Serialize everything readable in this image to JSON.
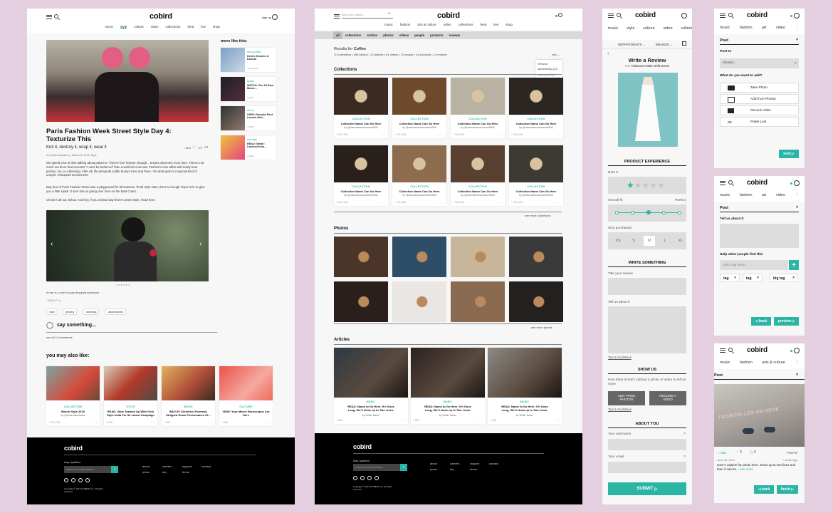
{
  "brand": "cobird",
  "colors": {
    "accent": "#2bb5a5",
    "background": "#e3cfe0",
    "footer": "#000000"
  },
  "article_page": {
    "header": {
      "signup": "sign up",
      "nav": [
        "music",
        "style",
        "culture",
        "video",
        "collections",
        "feed",
        "live",
        "shop"
      ],
      "active": "style"
    },
    "title": "Paris Fashion Week Street Style Day 4: Texturize This",
    "subtitle": "Knit it, destroy it, wrap it, wear it",
    "byline": "by Hayden Macaleno | March 04, 2018 | Style",
    "add_label": "+ ADD",
    "like_count": "270",
    "para1": "We spend a lot of time talking about patterns—they're fun! Texture, though... texture deserves more love. There's not much out there that screams \"I can't be bothered\" than a well-knit overcoat. Fashion's love affair with teddy bear jackets, too, is a blessing. After all, life demands a little texture here and there. It's what gives it a special kind of oomph. Chutzpah! Excitement!",
    "para2": "Day four of Paris Fashion Week was a playground for all textures. Timid style stars, there's enough inspo here to give you a little spark. It sure has us going over here on the East Coast.",
    "para3": "Check it all out, below. And hey, if you missed day three's street style, head here.",
    "caption": "A rose is a rose is a jaw-dropping accessory.",
    "tags": [
      "rose",
      "jewelry",
      "earrings",
      "accessories"
    ],
    "say_something": "say something...",
    "see_comments": "see all 15 comments",
    "more_like_this": "more like this:",
    "sidebar": [
      {
        "category": "COLLECTION",
        "title": "Denim Dreams & Donuts",
        "meta": "+ FOLLOW"
      },
      {
        "category": "MUSIC",
        "title": "WATCH: The 15 Best Music...",
        "meta": "+ ADD"
      },
      {
        "category": "STYLE",
        "title": "VIEW: Favorite Post Launch Nail...",
        "meta": "+ ADD"
      },
      {
        "category": "CULTURE",
        "title": "READ: What I Learned from...",
        "meta": "+ ADD"
      }
    ],
    "you_may_like": "you may also like:",
    "related": [
      {
        "category": "COLLECTION",
        "title": "Beach Style 2018",
        "sub": "by @bohemianchicna",
        "meta": "+ FOLLOW"
      },
      {
        "category": "STYLE",
        "title": "READ: Vans Teamed Up With Girls Style India For Its Latest Campaign",
        "sub": "",
        "meta": "+ ADD"
      },
      {
        "category": "MUSIC",
        "title": "WATCH: Kiersha's Powerful, Stripped Down Performance Of...",
        "sub": "",
        "meta": "+ ADD"
      },
      {
        "category": "CULTURE",
        "title": "VIEW: Your March Horoscopes Are Here",
        "sub": "",
        "meta": "+ ADD"
      }
    ]
  },
  "search_page": {
    "search_placeholder": "type your search ...",
    "nav": [
      "music",
      "fashion",
      "arts & culture",
      "video",
      "collections",
      "feed",
      "live",
      "shop"
    ],
    "filters": [
      "all",
      "collections",
      "articles",
      "photos",
      "videos",
      "people",
      "products",
      "reviews"
    ],
    "results_label": "Results for",
    "query": "Coffee",
    "counts": "10 collections • 465 photos • 22 articles • 81 videos • 31 people • 14 products • 12 reviews",
    "sort": "sort",
    "sort_options": [
      "relevance",
      "alphabetically (A-Z)",
      "most recent first",
      "oldest first"
    ],
    "collections_heading": "Collections",
    "collection_card": {
      "category": "COLLECTION",
      "title": "Collection Name Can Go Here",
      "sub": "by @usernameusername9906",
      "meta": "+ FOLLOW"
    },
    "see_more_collections": "see more collections",
    "photos_heading": "Photos",
    "see_more_photos": "see more photos",
    "articles_heading": "Articles",
    "article_card": {
      "category": "MUSIC",
      "title": "READ: Name to Go Here. If It Goes Long, We'll show up to Two Lines.",
      "sub": "by Writer Name",
      "meta": "+ ADD"
    }
  },
  "footer": {
    "stay_updated": "stay updated",
    "email_placeholder": "enter your email address",
    "links": [
      "about",
      "careers",
      "support",
      "contact",
      "press",
      "faq",
      "terms"
    ],
    "copyright": "Copyright © 2018 COBIRD, Inc. All rights reserved."
  },
  "review_page": {
    "nav": [
      "music",
      "style",
      "culture",
      "video",
      "collect"
    ],
    "departments": "DEPARTMENTS",
    "brands": "BRANDS",
    "title": "Write a Review",
    "for_label": "FOR",
    "product": "Tularosa Hattie Shift Dress",
    "product_experience": "PRODUCT EXPERIENCE",
    "rate_it": "Rate it",
    "rating": 1,
    "rating_max": 5,
    "overall_fit": "Overall fit",
    "fit_perfect": "Perfect",
    "fit_selected": 3,
    "size_purchased": "Size purchased",
    "sizes": [
      "XS",
      "S",
      "M",
      "L",
      "XL"
    ],
    "size_selected": "M",
    "write_something": "WRITE SOMETHING",
    "title_review": "Title your review",
    "tell_us": "Tell us about it",
    "guidelines": "Tips & Guidelines",
    "show_us": "SHOW US",
    "show_us_prompt": "How does it look? Upload a photo or video to tell us more",
    "add_photos": "ADD FROM PHOTOS",
    "record_video": "RECORD A VIDEO",
    "guidelines2": "Tips & Guidelines",
    "about_you": "ABOUT YOU",
    "username": "Your username",
    "email": "Your email",
    "submit": "SUBMIT"
  },
  "post_step1": {
    "nav": [
      "music",
      "fashion",
      "art",
      "video"
    ],
    "post": "Post",
    "post_to": "Post to",
    "choose": "choose...",
    "what_add": "What do you want to add?",
    "options": [
      "Take Photo",
      "Add from Photos",
      "Record Video",
      "Paste Link"
    ],
    "next": "next"
  },
  "post_step2": {
    "nav": [
      "music",
      "fashion",
      "art",
      "video"
    ],
    "post": "Post",
    "tell_us": "Tell us about it",
    "help_find": "Help other people find this",
    "tag_placeholder": "Add a tag name",
    "tags": [
      "tag",
      "tag",
      "big tag"
    ],
    "back": "back",
    "preview": "preview"
  },
  "post_step3": {
    "nav": [
      "music",
      "fashion",
      "arts & culture"
    ],
    "post": "Post",
    "image_text": "FASHION LED US HERE",
    "add": "+ ADD",
    "likes": "0",
    "comments": "0",
    "type": "PHOTO",
    "date": "June 25, 2017",
    "show_tags": "+ show tags",
    "caption": "User's caption for photo here. Show up to two lines and then it can be...",
    "see_more": "see more",
    "back": "back",
    "finish": "finish"
  }
}
